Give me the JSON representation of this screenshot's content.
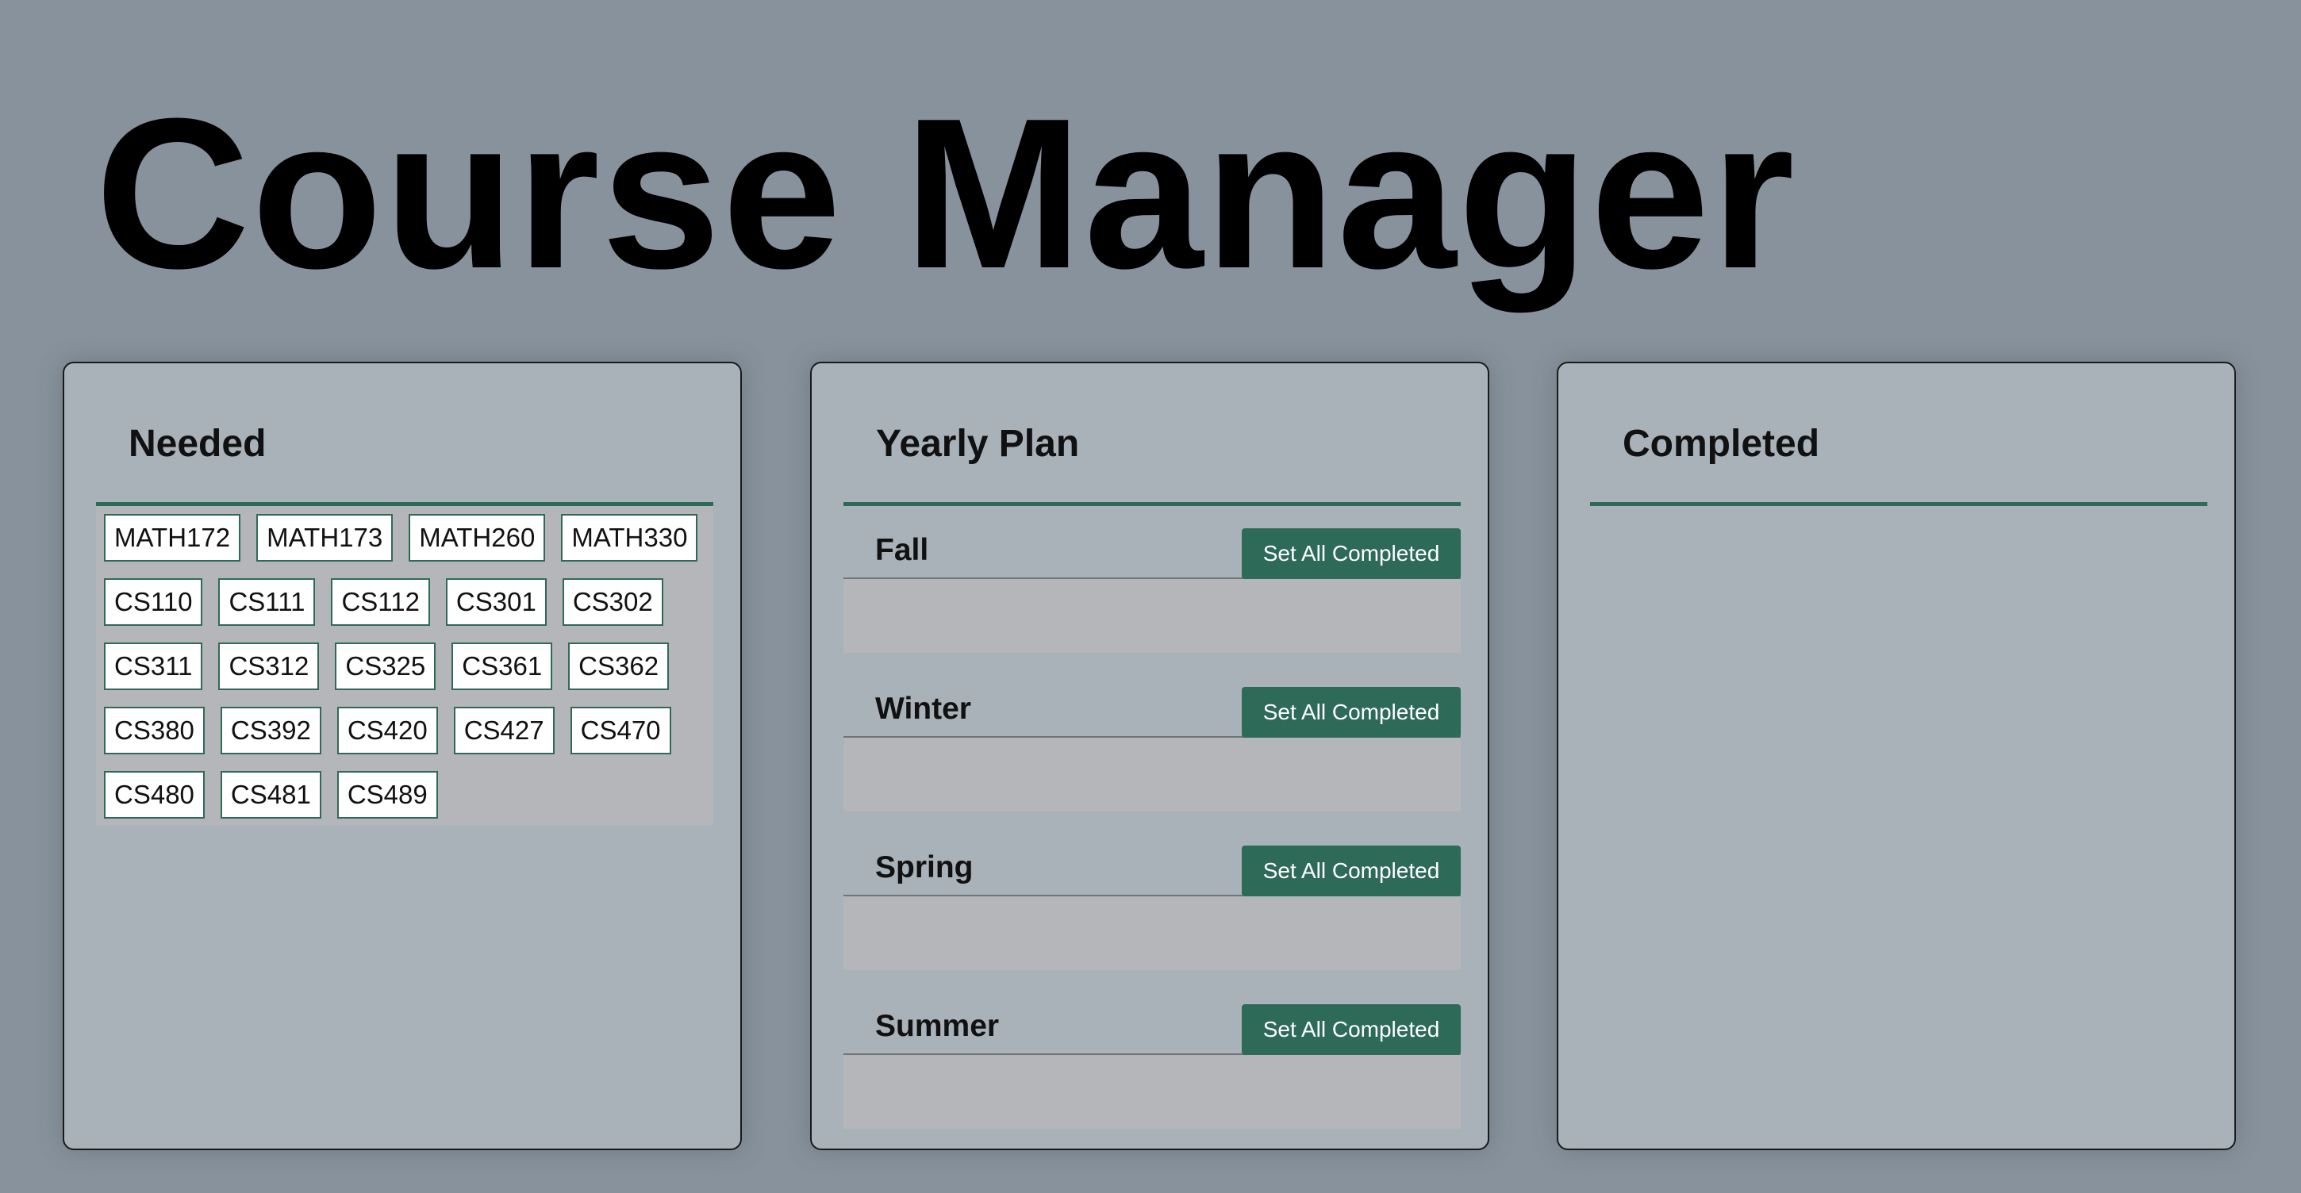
{
  "app": {
    "title": "Course Manager"
  },
  "needed": {
    "heading": "Needed",
    "rows": [
      [
        "MATH172",
        "MATH173",
        "MATH260",
        "MATH330"
      ],
      [
        "CS110",
        "CS111",
        "CS112",
        "CS301",
        "CS302"
      ],
      [
        "CS311",
        "CS312",
        "CS325",
        "CS361",
        "CS362"
      ],
      [
        "CS380",
        "CS392",
        "CS420",
        "CS427",
        "CS470"
      ],
      [
        "CS480",
        "CS481",
        "CS489"
      ]
    ]
  },
  "plan": {
    "heading": "Yearly Plan",
    "terms": [
      {
        "label": "Fall",
        "button": "Set All Completed"
      },
      {
        "label": "Winter",
        "button": "Set All Completed"
      },
      {
        "label": "Spring",
        "button": "Set All Completed"
      },
      {
        "label": "Summer",
        "button": "Set All Completed"
      }
    ]
  },
  "completed": {
    "heading": "Completed"
  },
  "colors": {
    "background": "#87929c",
    "panel": "#a9b1b9",
    "accent": "#2d6a57",
    "drop_zone": "#b4b6b9"
  }
}
